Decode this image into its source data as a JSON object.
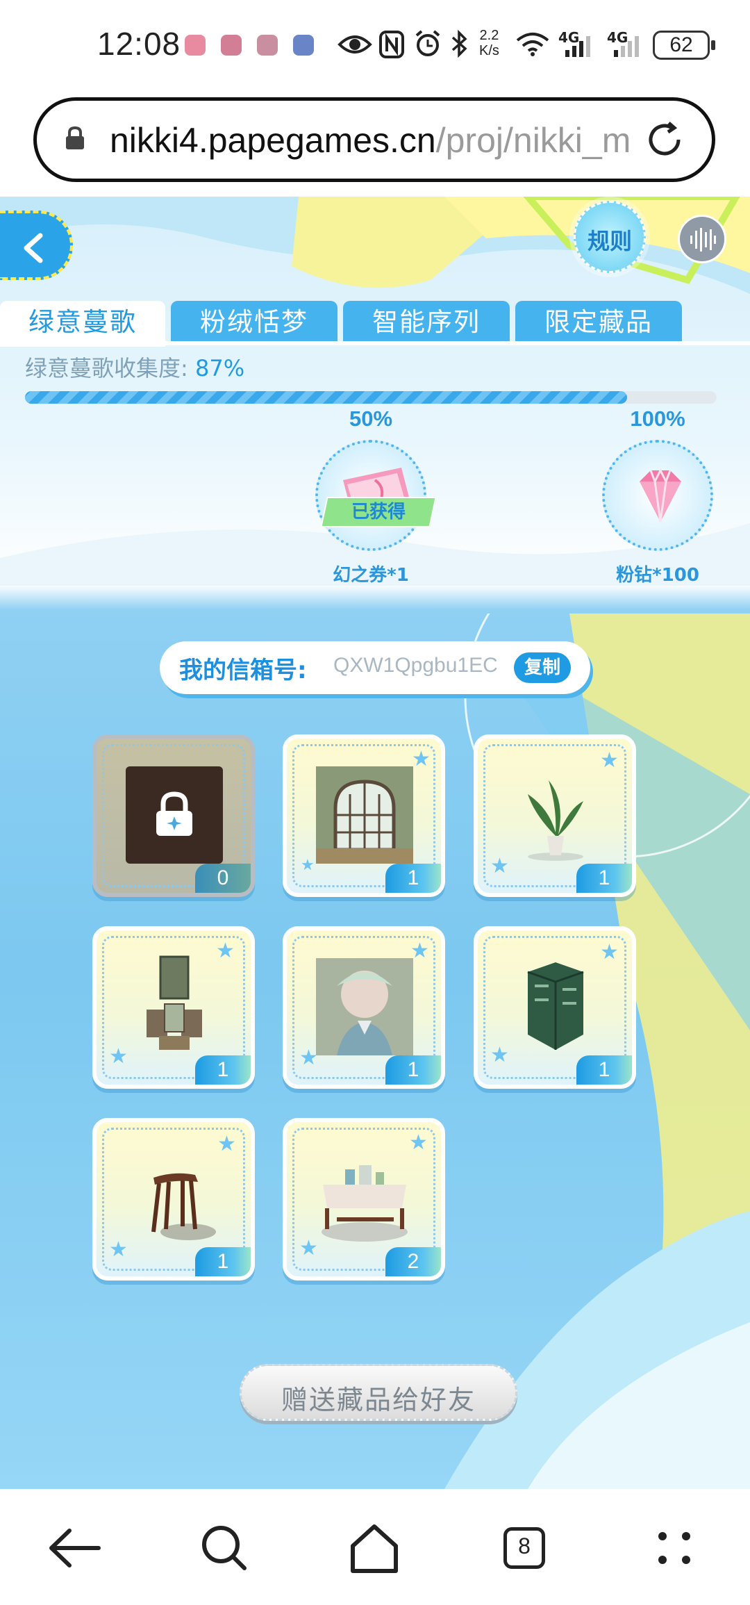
{
  "status_bar": {
    "time": "12:08",
    "net_speed_value": "2.2",
    "net_speed_unit": "K/s",
    "signal_1": "4G",
    "signal_2": "4G",
    "battery": "62"
  },
  "browser": {
    "url_host": "nikki4.papegames.cn",
    "url_path": "/proj/nikki_m"
  },
  "game": {
    "tabs": [
      {
        "label": "绿意蔓歌",
        "active": true
      },
      {
        "label": "粉绒恬梦",
        "active": false
      },
      {
        "label": "智能序列",
        "active": false
      },
      {
        "label": "限定藏品",
        "active": false
      }
    ],
    "rules_label": "规则",
    "progress": {
      "label": "绿意蔓歌收集度:",
      "value_text": "87%",
      "fraction": 0.87
    },
    "milestones": [
      {
        "percent": "50%",
        "reward": "幻之券*1",
        "badge": "已获得"
      },
      {
        "percent": "100%",
        "reward": "粉钻*100"
      }
    ],
    "mailbox": {
      "label": "我的信箱号:",
      "code": "QXW1Qpgbu1EC",
      "copy_label": "复制"
    },
    "items": [
      {
        "name": "locked-item",
        "count": "0",
        "locked": true
      },
      {
        "name": "arched-window",
        "count": "1"
      },
      {
        "name": "potted-plant",
        "count": "1"
      },
      {
        "name": "wall-decor-set",
        "count": "1"
      },
      {
        "name": "portrait-painting",
        "count": "1"
      },
      {
        "name": "wallpaper-panel",
        "count": "1"
      },
      {
        "name": "wooden-stool",
        "count": "1"
      },
      {
        "name": "table-set",
        "count": "2"
      }
    ],
    "gift_button": "赠送藏品给好友"
  },
  "nav": {
    "tab_count": "8",
    "icons": [
      "back-icon",
      "search-icon",
      "home-icon",
      "tabs-icon",
      "menu-icon"
    ]
  }
}
